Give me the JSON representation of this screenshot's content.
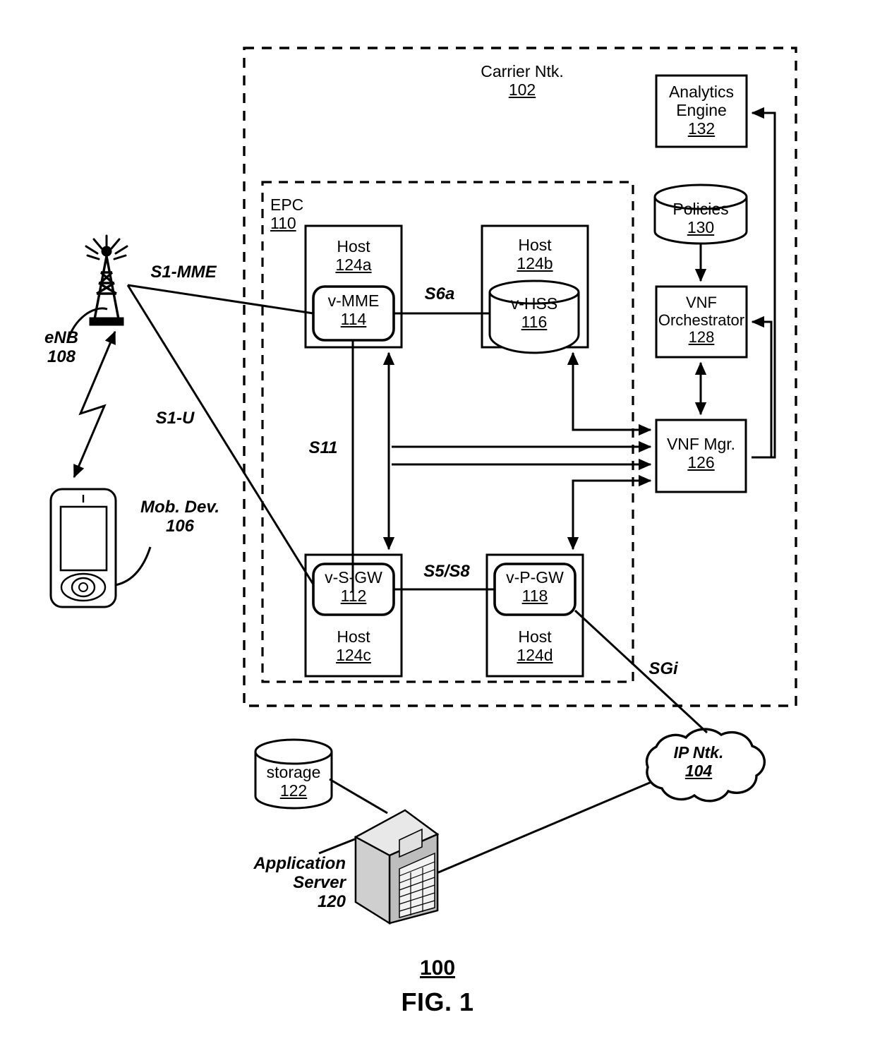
{
  "figure": {
    "number_label": "100",
    "caption": "FIG. 1"
  },
  "containers": {
    "carrier_network": {
      "title": "Carrier Ntk.",
      "ref": "102",
      "style": "dashed-box"
    },
    "epc": {
      "title": "EPC",
      "ref": "110",
      "style": "dashed-box"
    }
  },
  "nodes": {
    "host_124a": {
      "title": "Host",
      "ref": "124a"
    },
    "host_124b": {
      "title": "Host",
      "ref": "124b"
    },
    "host_124c": {
      "title": "Host",
      "ref": "124c"
    },
    "host_124d": {
      "title": "Host",
      "ref": "124d"
    },
    "v_mme": {
      "title": "v-MME",
      "ref": "114",
      "shape": "rounded-rect"
    },
    "v_hss": {
      "title": "v-HSS",
      "ref": "116",
      "shape": "cylinder"
    },
    "v_sgw": {
      "title": "v-S-GW",
      "ref": "112",
      "shape": "rounded-rect"
    },
    "v_pgw": {
      "title": "v-P-GW",
      "ref": "118",
      "shape": "rounded-rect"
    },
    "analytics_engine": {
      "title_line1": "Analytics",
      "title_line2": "Engine",
      "ref": "132",
      "shape": "rect"
    },
    "policies": {
      "title": "Policies",
      "ref": "130",
      "shape": "cylinder"
    },
    "vnf_orchestrator": {
      "title_line1": "VNF",
      "title_line2": "Orchestrator",
      "ref": "128",
      "shape": "rect"
    },
    "vnf_mgr": {
      "title": "VNF Mgr.",
      "ref": "126",
      "shape": "rect"
    },
    "enb": {
      "title": "eNB",
      "ref": "108",
      "shape": "tower-icon"
    },
    "mobile_device": {
      "title_line1": "Mob. Dev.",
      "ref": "106",
      "shape": "phone-icon"
    },
    "application_server": {
      "title_line1": "Application",
      "title_line2": "Server",
      "ref": "120",
      "shape": "server-icon"
    },
    "storage": {
      "title": "storage",
      "ref": "122",
      "shape": "cylinder"
    },
    "ip_network": {
      "title": "IP Ntk.",
      "ref": "104",
      "shape": "cloud"
    }
  },
  "interface_labels": {
    "s1_mme": "S1-MME",
    "s1_u": "S1-U",
    "s6a": "S6a",
    "s11": "S11",
    "s5_s8": "S5/S8",
    "sgi": "SGi"
  },
  "colors": {
    "line": "#000000",
    "background": "#ffffff",
    "fill": "#ffffff"
  }
}
